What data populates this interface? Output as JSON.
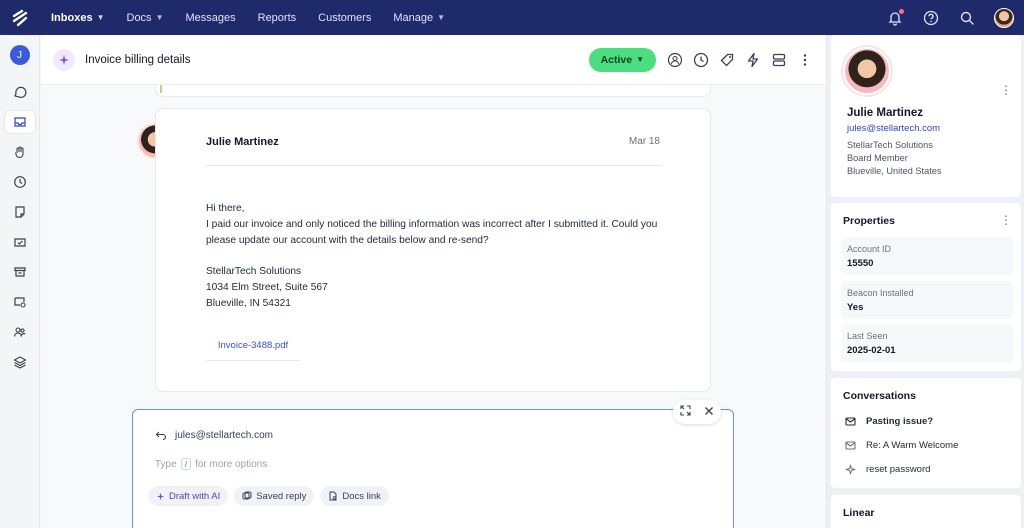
{
  "nav": {
    "items": [
      {
        "label": "Inboxes",
        "caret": true
      },
      {
        "label": "Docs",
        "caret": true
      },
      {
        "label": "Messages",
        "caret": false
      },
      {
        "label": "Reports",
        "caret": false
      },
      {
        "label": "Customers",
        "caret": false
      },
      {
        "label": "Manage",
        "caret": true
      }
    ]
  },
  "rail": {
    "avatar_initial": "J"
  },
  "conversation": {
    "title": "Invoice billing details",
    "status": "Active"
  },
  "message": {
    "sender": "Julie Martinez",
    "date": "Mar 18",
    "greeting": "Hi there,",
    "body": "I paid our invoice and only noticed the billing information was  incorrect after I submitted it. Could you please update our account with the details below and re-send?",
    "address": [
      "StellarTech Solutions",
      "1034 Elm Street, Suite 567",
      "Blueville, IN 54321"
    ],
    "attachment": "Invoice-3488.pdf"
  },
  "composer": {
    "reply_to": "jules@stellartech.com",
    "placeholder_before": "Type",
    "placeholder_key": "/",
    "placeholder_after": "for more options",
    "chips": [
      "Draft with AI",
      "Saved reply",
      "Docs link"
    ]
  },
  "contact": {
    "name": "Julie Martinez",
    "email": "jules@stellartech.com",
    "company": "StellarTech Solutions",
    "role": "Board Member",
    "location": "Blueville, United States"
  },
  "properties": {
    "title": "Properties",
    "items": [
      {
        "label": "Account ID",
        "value": "15550"
      },
      {
        "label": "Beacon Installed",
        "value": "Yes"
      },
      {
        "label": "Last Seen",
        "value": "2025-02-01"
      }
    ]
  },
  "conversations": {
    "title": "Conversations",
    "items": [
      "Pasting issue?",
      "Re: A Warm Welcome",
      "reset password"
    ]
  },
  "linear": {
    "title": "Linear"
  },
  "colors": {
    "nav_bg": "#1f2a6b",
    "status_green": "#4ade80",
    "accent_blue": "#2f46c9",
    "composer_border": "#6b8cff"
  }
}
